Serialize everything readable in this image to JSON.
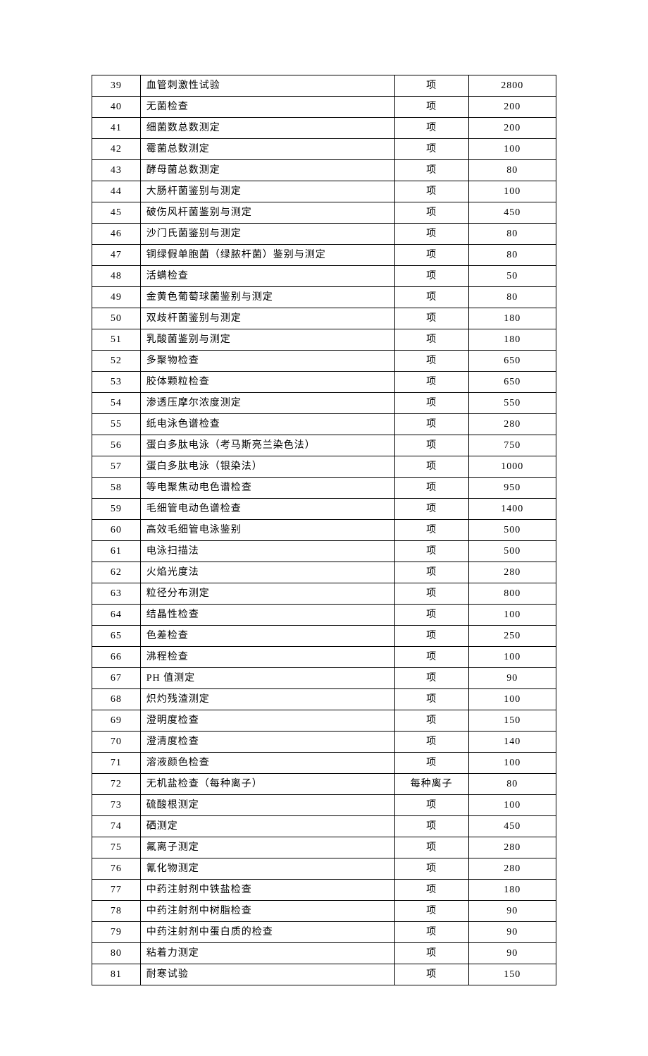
{
  "rows": [
    {
      "num": "39",
      "name": "血管刺激性试验",
      "unit": "项",
      "price": "2800"
    },
    {
      "num": "40",
      "name": "无菌检查",
      "unit": "项",
      "price": "200"
    },
    {
      "num": "41",
      "name": "细菌数总数测定",
      "unit": "项",
      "price": "200"
    },
    {
      "num": "42",
      "name": "霉菌总数测定",
      "unit": "项",
      "price": "100"
    },
    {
      "num": "43",
      "name": "酵母菌总数测定",
      "unit": "项",
      "price": "80"
    },
    {
      "num": "44",
      "name": "大肠杆菌鉴别与测定",
      "unit": "项",
      "price": "100"
    },
    {
      "num": "45",
      "name": "破伤风杆菌鉴别与测定",
      "unit": "项",
      "price": "450"
    },
    {
      "num": "46",
      "name": "沙门氏菌鉴别与测定",
      "unit": "项",
      "price": "80"
    },
    {
      "num": "47",
      "name": "铜绿假单胞菌（绿脓杆菌）鉴别与测定",
      "unit": "项",
      "price": "80"
    },
    {
      "num": "48",
      "name": "活螨检查",
      "unit": "项",
      "price": "50"
    },
    {
      "num": "49",
      "name": "金黄色葡萄球菌鉴别与测定",
      "unit": "项",
      "price": "80"
    },
    {
      "num": "50",
      "name": "双歧杆菌鉴别与测定",
      "unit": "项",
      "price": "180"
    },
    {
      "num": "51",
      "name": "乳酸菌鉴别与测定",
      "unit": "项",
      "price": "180"
    },
    {
      "num": "52",
      "name": "多聚物检查",
      "unit": "项",
      "price": "650"
    },
    {
      "num": "53",
      "name": "胶体颗粒检查",
      "unit": "项",
      "price": "650"
    },
    {
      "num": "54",
      "name": "渗透压摩尔浓度测定",
      "unit": "项",
      "price": "550"
    },
    {
      "num": "55",
      "name": "纸电泳色谱检查",
      "unit": "项",
      "price": "280"
    },
    {
      "num": "56",
      "name": "蛋白多肽电泳（考马斯亮兰染色法）",
      "unit": "项",
      "price": "750"
    },
    {
      "num": "57",
      "name": "蛋白多肽电泳（银染法）",
      "unit": "项",
      "price": "1000"
    },
    {
      "num": "58",
      "name": "等电聚焦动电色谱检查",
      "unit": "项",
      "price": "950"
    },
    {
      "num": "59",
      "name": "毛细管电动色谱检查",
      "unit": "项",
      "price": "1400"
    },
    {
      "num": "60",
      "name": "高效毛细管电泳鉴别",
      "unit": "项",
      "price": "500"
    },
    {
      "num": "61",
      "name": "电泳扫描法",
      "unit": "项",
      "price": "500"
    },
    {
      "num": "62",
      "name": "火焰光度法",
      "unit": "项",
      "price": "280"
    },
    {
      "num": "63",
      "name": "粒径分布测定",
      "unit": "项",
      "price": "800"
    },
    {
      "num": "64",
      "name": "结晶性检查",
      "unit": "项",
      "price": "100"
    },
    {
      "num": "65",
      "name": "色差检查",
      "unit": "项",
      "price": "250"
    },
    {
      "num": "66",
      "name": "沸程检查",
      "unit": "项",
      "price": "100"
    },
    {
      "num": "67",
      "name": "PH 值测定",
      "unit": "项",
      "price": "90"
    },
    {
      "num": "68",
      "name": "炽灼残渣测定",
      "unit": "项",
      "price": "100"
    },
    {
      "num": "69",
      "name": "澄明度检查",
      "unit": "项",
      "price": "150"
    },
    {
      "num": "70",
      "name": "澄清度检查",
      "unit": "项",
      "price": "140"
    },
    {
      "num": "71",
      "name": "溶液颜色检查",
      "unit": "项",
      "price": "100"
    },
    {
      "num": "72",
      "name": "无机盐检查（每种离子）",
      "unit": "每种离子",
      "price": "80"
    },
    {
      "num": "73",
      "name": "硫酸根测定",
      "unit": "项",
      "price": "100"
    },
    {
      "num": "74",
      "name": "硒测定",
      "unit": "项",
      "price": "450"
    },
    {
      "num": "75",
      "name": "氟离子测定",
      "unit": "项",
      "price": "280"
    },
    {
      "num": "76",
      "name": "氰化物测定",
      "unit": "项",
      "price": "280"
    },
    {
      "num": "77",
      "name": "中药注射剂中铁盐检查",
      "unit": "项",
      "price": "180"
    },
    {
      "num": "78",
      "name": "中药注射剂中树脂检查",
      "unit": "项",
      "price": "90"
    },
    {
      "num": "79",
      "name": "中药注射剂中蛋白质的检查",
      "unit": "项",
      "price": "90"
    },
    {
      "num": "80",
      "name": "粘着力测定",
      "unit": "项",
      "price": "90"
    },
    {
      "num": "81",
      "name": "耐寒试验",
      "unit": "项",
      "price": "150"
    }
  ]
}
